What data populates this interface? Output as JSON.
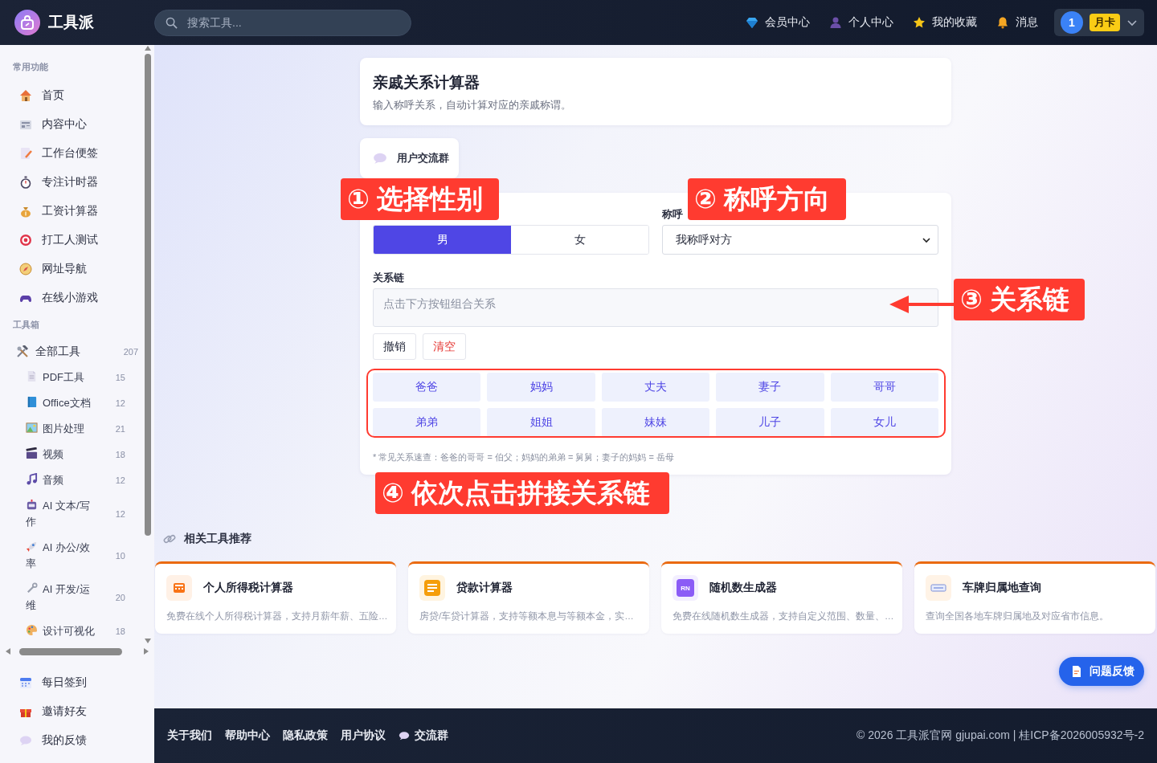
{
  "header": {
    "brand": "工具派",
    "search": {
      "placeholder": "搜索工具..."
    },
    "nav": [
      {
        "label": "会员中心"
      },
      {
        "label": "个人中心"
      },
      {
        "label": "我的收藏"
      },
      {
        "label": "消息"
      }
    ],
    "user": {
      "avatar": "1",
      "badge": "月卡"
    }
  },
  "sidebar": {
    "sections": [
      {
        "title": "常用功能",
        "items": [
          {
            "label": "首页"
          },
          {
            "label": "内容中心"
          },
          {
            "label": "工作台便签"
          },
          {
            "label": "专注计时器"
          },
          {
            "label": "工资计算器"
          },
          {
            "label": "打工人测试"
          },
          {
            "label": "网址导航"
          },
          {
            "label": "在线小游戏"
          }
        ]
      },
      {
        "title": "工具箱",
        "items": [
          {
            "label": "全部工具",
            "count": "207",
            "children": [
              {
                "label": "PDF工具",
                "count": "15"
              },
              {
                "label": "Office文档",
                "count": "12"
              },
              {
                "label": "图片处理",
                "count": "21"
              },
              {
                "label": "视频",
                "count": "18"
              },
              {
                "label": "音频",
                "count": "12"
              },
              {
                "label": "AI 文本/写作",
                "count": "12"
              },
              {
                "label": "AI 办公/效率",
                "count": "10"
              },
              {
                "label": "AI 开发/运维",
                "count": "20"
              },
              {
                "label": "设计可视化",
                "count": "18"
              }
            ]
          }
        ]
      }
    ],
    "bottom_items": [
      {
        "label": "每日签到"
      },
      {
        "label": "邀请好友"
      },
      {
        "label": "我的反馈"
      }
    ]
  },
  "page": {
    "title": "亲戚关系计算器",
    "subtitle": "输入称呼关系，自动计算对应的亲戚称谓。",
    "group_chip": "用户交流群"
  },
  "form": {
    "gender": [
      {
        "label": "男",
        "selected": true
      },
      {
        "label": "女",
        "selected": false
      }
    ],
    "direction": {
      "label": "称呼",
      "value": "我称呼对方"
    },
    "chain": {
      "label": "关系链",
      "placeholder": "点击下方按钮组合关系"
    },
    "actions": [
      {
        "label": "撤销",
        "kind": "normal"
      },
      {
        "label": "清空",
        "kind": "danger"
      }
    ],
    "relations": [
      "爸爸",
      "妈妈",
      "丈夫",
      "妻子",
      "哥哥",
      "弟弟",
      "姐姐",
      "妹妹",
      "儿子",
      "女儿"
    ],
    "note": "* 常见关系速查：爸爸的哥哥 = 伯父；妈妈的弟弟 = 舅舅；妻子的妈妈 = 岳母"
  },
  "annotations": [
    {
      "kind": "callout",
      "text": "① 选择性别",
      "arrow": false
    },
    {
      "kind": "callout",
      "text": "② 称呼方向",
      "arrow": false
    },
    {
      "kind": "callout",
      "text": "③ 关系链",
      "arrow": true
    },
    {
      "kind": "frame"
    },
    {
      "kind": "callout",
      "text": "④ 依次点击拼接关系链",
      "arrow": false
    }
  ],
  "related": {
    "title": "相关工具推荐",
    "cards": [
      {
        "title": "个人所得税计算器",
        "desc": "免费在线个人所得税计算器，支持月薪年薪、五险…"
      },
      {
        "title": "贷款计算器",
        "desc": "房贷/车贷计算器，支持等额本息与等额本金，实…"
      },
      {
        "title": "随机数生成器",
        "desc": "免费在线随机数生成器，支持自定义范围、数量、…",
        "icon_text": "RN"
      },
      {
        "title": "车牌归属地查询",
        "desc": "查询全国各地车牌归属地及对应省市信息。"
      }
    ]
  },
  "feedback_button": "问题反馈",
  "footer": {
    "links": [
      "关于我们",
      "帮助中心",
      "隐私政策",
      "用户协议"
    ],
    "group": "交流群",
    "copyright": "© 2026 工具派官网 gjupai.com | 桂ICP备2026005932号-2"
  }
}
